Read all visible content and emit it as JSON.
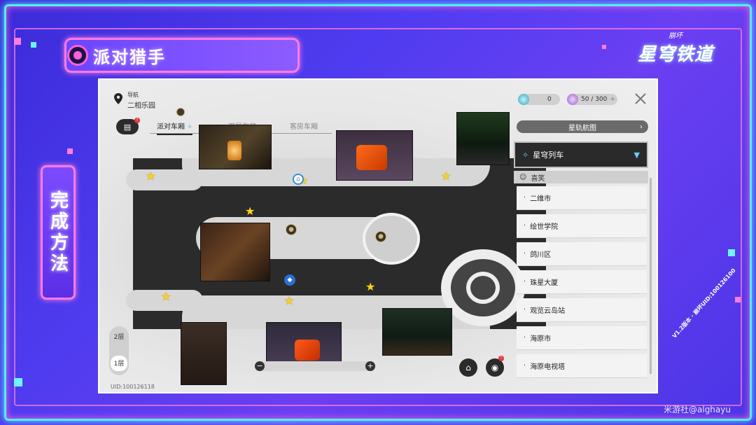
{
  "title": "派对猎手",
  "side_label": "完成方法",
  "logo": {
    "small": "崩坏",
    "big": "星穹铁道"
  },
  "version_tag": "V1.2版本 · 崩坏UID:100126100",
  "watermark": "米游社@alghayu",
  "game": {
    "nav": {
      "label": "导航",
      "location": "二相乐园"
    },
    "tabs": [
      {
        "label": "派对车厢",
        "active": true
      },
      {
        "label": "观景车厢",
        "active": false
      },
      {
        "label": "客房车厢",
        "active": false
      }
    ],
    "resources": [
      {
        "icon": "stellar-jade-icon",
        "value": "0"
      },
      {
        "icon": "reserved-power-icon",
        "value": "50 / 300"
      }
    ],
    "star_rail_map_label": "星轨航图",
    "selected_world": "星穹列车",
    "group_header": "喜笑",
    "locations": [
      "二维市",
      "绘世学院",
      "鸽川区",
      "珠星大厦",
      "观览云岛站",
      "海原市",
      "海原电视塔"
    ],
    "floors": [
      "2层",
      "1层"
    ],
    "selected_floor": "1层",
    "uid": "UID:100126118",
    "colors": {
      "accent": "#4ff0ff",
      "pink": "#ff7be2",
      "star": "#ffd21a",
      "panel_dark": "#2a2a2a"
    }
  }
}
